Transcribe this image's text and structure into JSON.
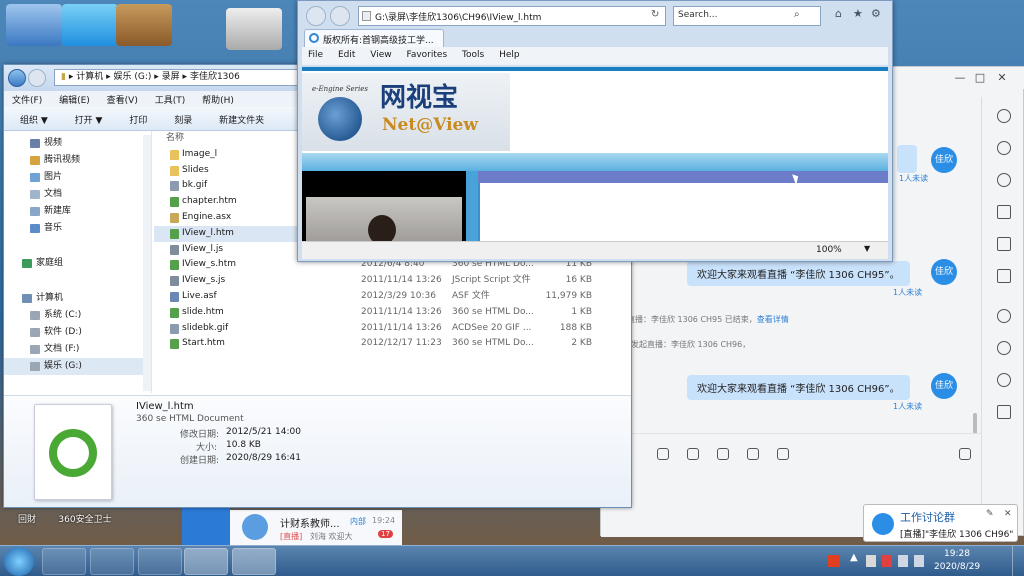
{
  "desktop": {
    "icons_bottom": [
      "回財",
      "360安全卫士"
    ]
  },
  "explorer": {
    "breadcrumb": [
      "计算机",
      "娱乐 (G:)",
      "录屏",
      "李佳欣1306"
    ],
    "menu": [
      "文件(F)",
      "编辑(E)",
      "查看(V)",
      "工具(T)",
      "帮助(H)"
    ],
    "toolbar": [
      "组织 ▼",
      "打开 ▼",
      "打印",
      "刻录",
      "新建文件夹"
    ],
    "nav_items": [
      {
        "label": "视频",
        "color": "#6a7fa8"
      },
      {
        "label": "腾讯视频",
        "color": "#d6a341"
      },
      {
        "label": "图片",
        "color": "#6ea3d6"
      },
      {
        "label": "文档",
        "color": "#a0b4cc"
      },
      {
        "label": "新建库",
        "color": "#8aa6c8"
      },
      {
        "label": "音乐",
        "color": "#5b8dc9"
      },
      {
        "label": "家庭组",
        "color": "#3b9a5c"
      },
      {
        "label": "计算机",
        "color": "#6f8fb6"
      },
      {
        "label": "系统 (C:)",
        "color": "#9aa6b3"
      },
      {
        "label": "软件 (D:)",
        "color": "#9aa6b3"
      },
      {
        "label": "文档 (F:)",
        "color": "#9aa6b3"
      },
      {
        "label": "娱乐 (G:)",
        "color": "#9aa6b3"
      }
    ],
    "column_header": "名称",
    "files": [
      {
        "name": "Image_l",
        "date": "",
        "type": "",
        "size": "",
        "color": "#e8c25a"
      },
      {
        "name": "Slides",
        "date": "",
        "type": "",
        "size": "",
        "color": "#e8c25a"
      },
      {
        "name": "bk.gif",
        "date": "",
        "type": "",
        "size": "",
        "color": "#8a9bb0"
      },
      {
        "name": "chapter.htm",
        "date": "",
        "type": "",
        "size": "",
        "color": "#55a04a"
      },
      {
        "name": "Engine.asx",
        "date": "",
        "type": "",
        "size": "",
        "color": "#c9a85a"
      },
      {
        "name": "IView_l.htm",
        "date": "",
        "type": "",
        "size": "",
        "color": "#55a04a"
      },
      {
        "name": "IView_l.js",
        "date": "",
        "type": "",
        "size": "",
        "color": "#7f8c9c"
      },
      {
        "name": "IView_s.htm",
        "date": "2012/6/4 8:40",
        "type": "360 se HTML Do...",
        "size": "11 KB",
        "color": "#55a04a"
      },
      {
        "name": "IView_s.js",
        "date": "2011/11/14 13:26",
        "type": "JScript Script 文件",
        "size": "16 KB",
        "color": "#7f8c9c"
      },
      {
        "name": "Live.asf",
        "date": "2012/3/29 10:36",
        "type": "ASF 文件",
        "size": "11,979 KB",
        "color": "#6a88b3"
      },
      {
        "name": "slide.htm",
        "date": "2011/11/14 13:26",
        "type": "360 se HTML Do...",
        "size": "1 KB",
        "color": "#55a04a"
      },
      {
        "name": "slidebk.gif",
        "date": "2011/11/14 13:26",
        "type": "ACDSee 20 GIF ...",
        "size": "188 KB",
        "color": "#8a9bb0"
      },
      {
        "name": "Start.htm",
        "date": "2012/12/17 11:23",
        "type": "360 se HTML Do...",
        "size": "2 KB",
        "color": "#55a04a"
      }
    ],
    "selected_index": 5,
    "details": {
      "filename": "IView_l.htm",
      "filetype": "360 se HTML Document",
      "modified_label": "修改日期:",
      "modified_value": "2012/5/21 14:00",
      "size_label": "大小:",
      "size_value": "10.8 KB",
      "created_label": "创建日期:",
      "created_value": "2020/8/29 16:41"
    }
  },
  "ie": {
    "address": "G:\\录屏\\李佳欣1306\\CH96\\IView_l.htm",
    "search_placeholder": "Search...",
    "tab_title": "版权所有:首钢高级技工学...",
    "menu": [
      "File",
      "Edit",
      "View",
      "Favorites",
      "Tools",
      "Help"
    ],
    "logo_small": "e-Engine Series",
    "logo_cn": "网视宝",
    "logo_en": "Net@View",
    "zoom": "100%"
  },
  "chat": {
    "avatar_label": "佳欣",
    "messages": [
      {
        "text": "",
        "read": "1人未读"
      },
      {
        "text": "欢迎大家来观看直播 “李佳欣 1306 CH95”。",
        "read": "1人未读"
      },
      {
        "text": "欢迎大家来观看直播 “李佳欣 1306 CH96”。",
        "read": "1人未读"
      }
    ],
    "system_msg_1": "直播：李佳欣 1306 CH95 已结束，",
    "system_link_1": "查看详情",
    "system_msg_2": "发起直播：李佳欣 1306 CH96，"
  },
  "qq_preview": {
    "name": "计财系教师...",
    "tag": "内部",
    "time": "19:24",
    "preview_tag": "[直播]",
    "preview_text": "刘海 欢迎大",
    "badge": "17"
  },
  "notification": {
    "title": "工作讨论群",
    "body": "[直播]\"李佳欣 1306 CH96\""
  },
  "taskbar": {
    "time": "19:28",
    "date": "2020/8/29"
  }
}
